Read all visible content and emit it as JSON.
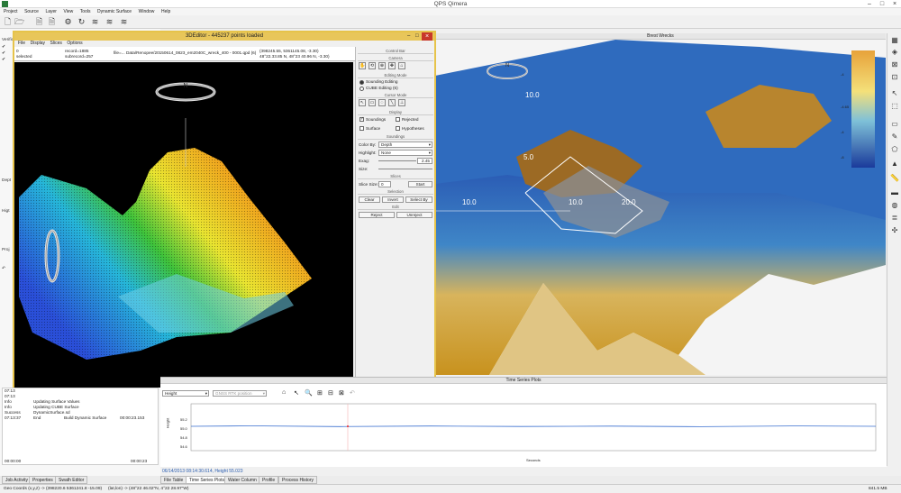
{
  "app": {
    "title": "QPS Qimera"
  },
  "menu": [
    "Project",
    "Source",
    "Layer",
    "View",
    "Tools",
    "Dynamic Surface",
    "Window",
    "Help"
  ],
  "left": {
    "verif": "Verific",
    "dept": "Dept",
    "hig": "Higt",
    "pro": "Proj"
  },
  "log": {
    "rows": [
      {
        "a": "07:13",
        "b": "",
        "c": ""
      },
      {
        "a": "07:13",
        "b": "",
        "c": ""
      },
      {
        "a": "Info",
        "b": "Updating Surface Values",
        "c": ""
      },
      {
        "a": "Info",
        "b": "Updating CUBE Surface",
        "c": ""
      },
      {
        "a": "Success",
        "b": "DynamicSurface.sd",
        "c": ""
      },
      {
        "a": "07:13:37",
        "b": "End",
        "c": "Build Dynamic Surface"
      }
    ],
    "elapsed": "00:00:23.153",
    "t1": "00:00:00",
    "t2": "00:00:23"
  },
  "editor": {
    "title": "3DEditor - 445237 points loaded",
    "menu": [
      "File",
      "Display",
      "Slices",
      "Options"
    ],
    "info": {
      "sel": "0",
      "selected": "selected",
      "record": "record=1885",
      "subrecord": "subrecord=257",
      "file": "file=... Data/Renopee/20150614_0823_em2040C_wreck_400 - 0001.qpd (6)",
      "coord1": "(398245.55, 5361145.08, -3.30)",
      "coord2": "48°22.33.85 N, 48°23 40.96 N, -3.30)"
    }
  },
  "control": {
    "title": "Control Bar",
    "camera": "Camera",
    "editing_mode": "Editing Mode",
    "sounding_editing": "Sounding Editing",
    "cube_editing": "CUBE Editing (6)",
    "cursor_mode": "Cursor Mode",
    "display": "Display",
    "soundings": "Soundings",
    "rejected": "Rejected",
    "surface": "Surface",
    "hypotheses": "Hypotheses",
    "soundings_sec": "Soundings",
    "color_by_label": "Color By:",
    "color_by_value": "Depth",
    "highlight_label": "Highlight:",
    "highlight_value": "None",
    "exag_label": "Exag:",
    "exag_value": "2.45",
    "size_label": "Size:",
    "slice_sec": "Slices",
    "slice_size_label": "Slice Size:",
    "slice_size_value": "0",
    "start": "Start",
    "selection_sec": "Selection",
    "clear": "Clear",
    "invert": "Invert",
    "select_by": "Select By",
    "edit_sec": "Edit",
    "reject": "Reject",
    "unreject": "Unreject"
  },
  "scene": {
    "title": "Brest Wrecks",
    "labels": [
      "10.0",
      "5.0",
      "10.0",
      "20.0",
      "10.0"
    ],
    "legend": [
      "-4",
      "-4.65",
      "-4",
      "-8"
    ]
  },
  "tsp": {
    "title": "Time Series Plots",
    "height_select": "Height",
    "gnss_select": "GNSS RTK position",
    "ylabel": "Height",
    "yticks": [
      "55.2",
      "55.0",
      "54.8",
      "54.6"
    ],
    "xlabel": "Seconds",
    "time": "06/14/2013 08:14:30.614, Height 55.023"
  },
  "tabs": [
    "Job Activity",
    "Properties",
    "Swath Editor",
    "File Table",
    "Time Series Plots",
    "Water Column",
    "Profile",
    "Process History"
  ],
  "status": {
    "geo": "Geo Coords (x,y,z) -> (398220.6 5361241.8 -15.09)",
    "latlon": "(lat,lon) -> (48°22 46.02\"N, 4°22 28.97\"W)",
    "mem": "841.5 MB"
  },
  "colors": {
    "accent": "#e6c34a",
    "chart_line": "#3a6fcf"
  }
}
